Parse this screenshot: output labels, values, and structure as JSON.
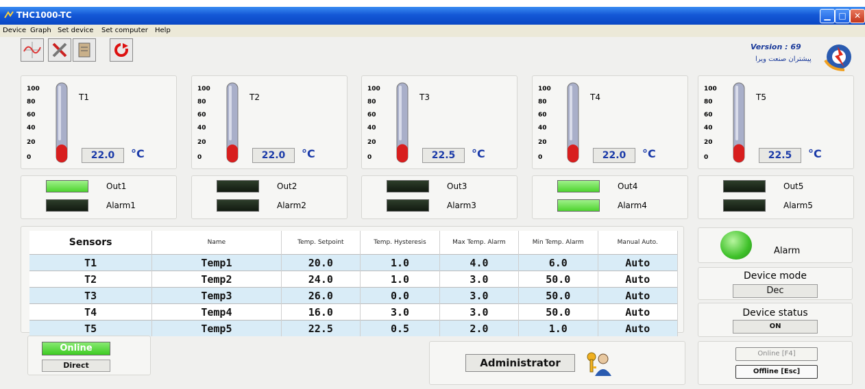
{
  "window": {
    "title": "THC1000-TC"
  },
  "menu": [
    "Device",
    "Graph",
    "Set device",
    "Set computer",
    "Help"
  ],
  "header": {
    "version": "Version : 69",
    "company": "پیشتران صنعت ویرا"
  },
  "thermometer_scale": [
    "100",
    "80",
    "60",
    "40",
    "20",
    "0"
  ],
  "sensors": [
    {
      "label": "T1",
      "value": "22.0",
      "unit": "°C",
      "level_percent": 22,
      "out_label": "Out1",
      "out_on": true,
      "alarm_label": "Alarm1",
      "alarm_on": false
    },
    {
      "label": "T2",
      "value": "22.0",
      "unit": "°C",
      "level_percent": 22,
      "out_label": "Out2",
      "out_on": false,
      "alarm_label": "Alarm2",
      "alarm_on": false
    },
    {
      "label": "T3",
      "value": "22.5",
      "unit": "°C",
      "level_percent": 22.5,
      "out_label": "Out3",
      "out_on": false,
      "alarm_label": "Alarm3",
      "alarm_on": false
    },
    {
      "label": "T4",
      "value": "22.0",
      "unit": "°C",
      "level_percent": 22,
      "out_label": "Out4",
      "out_on": true,
      "alarm_label": "Alarm4",
      "alarm_on": true
    },
    {
      "label": "T5",
      "value": "22.5",
      "unit": "°C",
      "level_percent": 22.5,
      "out_label": "Out5",
      "out_on": false,
      "alarm_label": "Alarm5",
      "alarm_on": false
    }
  ],
  "table": {
    "headers": [
      "Sensors",
      "Name",
      "Temp. Setpoint",
      "Temp. Hysteresis",
      "Max Temp. Alarm",
      "Min Temp. Alarm",
      "Manual Auto."
    ],
    "rows": [
      [
        "T1",
        "Temp1",
        "20.0",
        "1.0",
        "4.0",
        "6.0",
        "Auto"
      ],
      [
        "T2",
        "Temp2",
        "24.0",
        "1.0",
        "3.0",
        "50.0",
        "Auto"
      ],
      [
        "T3",
        "Temp3",
        "26.0",
        "0.0",
        "3.0",
        "50.0",
        "Auto"
      ],
      [
        "T4",
        "Temp4",
        "16.0",
        "3.0",
        "3.0",
        "50.0",
        "Auto"
      ],
      [
        "T5",
        "Temp5",
        "22.5",
        "0.5",
        "2.0",
        "1.0",
        "Auto"
      ]
    ]
  },
  "alarm": {
    "label": "Alarm"
  },
  "device_mode": {
    "title": "Device mode",
    "value": "Dec"
  },
  "device_status": {
    "title": "Device status",
    "value": "ON"
  },
  "connection": {
    "online_label": "Online",
    "mode": "Direct",
    "online_btn": "Online [F4]",
    "offline_btn": "Offline [Esc]"
  },
  "user": {
    "role": "Administrator"
  },
  "colors": {
    "led_on": "#4ed42f",
    "led_off": "#121a11",
    "row_alt": "#d9ecf7",
    "value_text": "#1a3aa8",
    "mercury": "#d81e1e"
  }
}
